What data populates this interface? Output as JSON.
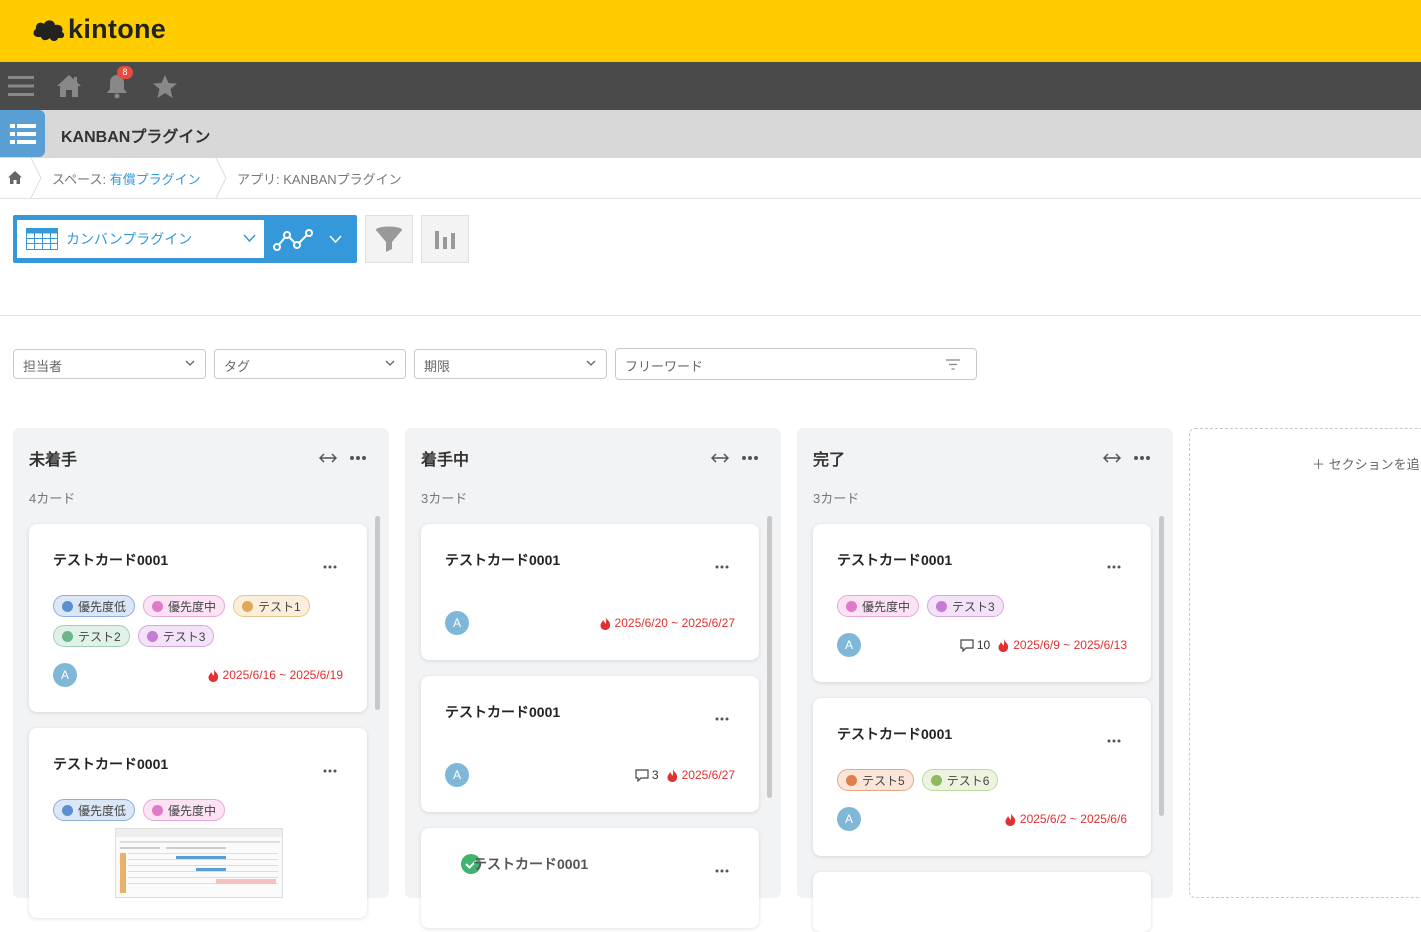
{
  "brand": {
    "logo_text": "kintone",
    "accent": "#ffcc00"
  },
  "nav": {
    "notification_count": "8"
  },
  "app": {
    "title": "KANBANプラグイン"
  },
  "breadcrumb": {
    "space_prefix": "スペース: ",
    "space_link": "有償プラグイン",
    "app_label": "アプリ: KANBANプラグイン"
  },
  "toolbar": {
    "view_name": "カンバンプラグイン"
  },
  "filters": {
    "assignee": "担当者",
    "tag": "タグ",
    "deadline": "期限",
    "freeword_placeholder": "フリーワード"
  },
  "columns": [
    {
      "title": "未着手",
      "count": "4カード",
      "cards": [
        {
          "title": "テストカード0001",
          "tags": [
            "優先度低",
            "優先度中",
            "テスト1",
            "テスト2",
            "テスト3"
          ],
          "avatar": "A",
          "date": "2025/6/16 ~ 2025/6/19"
        },
        {
          "title": "テストカード0001",
          "tags": [
            "優先度低",
            "優先度中"
          ]
        }
      ]
    },
    {
      "title": "着手中",
      "count": "3カード",
      "cards": [
        {
          "title": "テストカード0001",
          "avatar": "A",
          "date": "2025/6/20 ~ 2025/6/27"
        },
        {
          "title": "テストカード0001",
          "avatar": "A",
          "comments": "3",
          "date": "2025/6/27"
        },
        {
          "title": "テストカード0001"
        }
      ]
    },
    {
      "title": "完了",
      "count": "3カード",
      "cards": [
        {
          "title": "テストカード0001",
          "tags": [
            "優先度中",
            "テスト3"
          ],
          "avatar": "A",
          "comments": "10",
          "date": "2025/6/9 ~ 2025/6/13"
        },
        {
          "title": "テストカード0001",
          "tags": [
            "テスト5",
            "テスト6"
          ],
          "avatar": "A",
          "date": "2025/6/2 ~ 2025/6/6"
        }
      ]
    }
  ],
  "new_section": {
    "label": "＋ セクションを追"
  },
  "tag_colors": {
    "low": "#5b8fd0",
    "mid": "#e07ac8",
    "t1": "#e0a95a",
    "t2": "#6ab58a",
    "t3": "#c77ad6",
    "t5": "#e07d4e",
    "t6": "#8cba5c"
  }
}
